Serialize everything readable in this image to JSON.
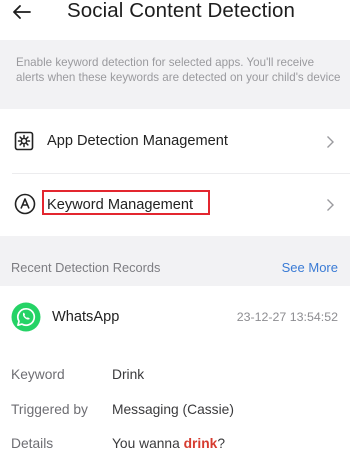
{
  "header": {
    "title": "Social Content Detection"
  },
  "notice": {
    "text": "Enable keyword detection for selected apps. You'll receive alerts when these keywords are detected on your child's device"
  },
  "menu": [
    {
      "label": "App Detection Management",
      "icon": "gear-square-icon"
    },
    {
      "label": "Keyword Management",
      "icon": "circle-a-icon"
    }
  ],
  "recent": {
    "title": "Recent Detection Records",
    "see_more": "See More",
    "record": {
      "app": "WhatsApp",
      "timestamp": "23-12-27 13:54:52",
      "keyword_label": "Keyword",
      "keyword_value": "Drink",
      "triggered_label": "Triggered by",
      "triggered_value": "Messaging (Cassie)",
      "details_label": "Details",
      "details_prefix": "You wanna ",
      "details_highlight": "drink",
      "details_suffix": "?"
    }
  },
  "colors": {
    "accent_link": "#3a7bd5",
    "highlight_box": "#e3262f",
    "keyword_highlight": "#d63b2f",
    "whatsapp_green": "#25d366",
    "section_gray": "#f2f2f4"
  }
}
